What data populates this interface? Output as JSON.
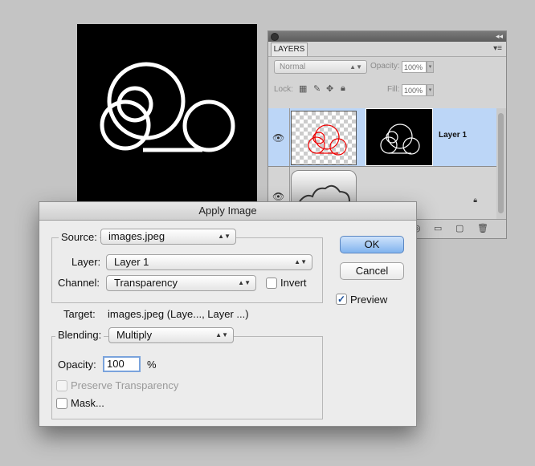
{
  "layers_panel": {
    "tab_label": "LAYERS",
    "blend_mode": "Normal",
    "opacity_label": "Opacity:",
    "opacity_value": "100%",
    "lock_label": "Lock:",
    "fill_label": "Fill:",
    "fill_value": "100%",
    "layers": [
      {
        "name": "Layer 1",
        "selected": true
      },
      {
        "name": "",
        "selected": false
      }
    ]
  },
  "dialog": {
    "title": "Apply Image",
    "source_label": "Source:",
    "source_value": "images.jpeg",
    "layer_label": "Layer:",
    "layer_value": "Layer 1",
    "channel_label": "Channel:",
    "channel_value": "Transparency",
    "invert_label": "Invert",
    "invert_checked": false,
    "target_label": "Target:",
    "target_value": "images.jpeg (Laye..., Layer ...)",
    "blending_label": "Blending:",
    "blending_value": "Multiply",
    "opacity_label": "Opacity:",
    "opacity_value": "100",
    "opacity_unit": "%",
    "preserve_label": "Preserve Transparency",
    "preserve_checked": false,
    "mask_label": "Mask...",
    "mask_checked": false,
    "ok_label": "OK",
    "cancel_label": "Cancel",
    "preview_label": "Preview",
    "preview_checked": true
  },
  "colors": {
    "selected_layer": "#bcd6f7",
    "default_button": "#80b3ee",
    "dialog_bg": "#ececec"
  }
}
